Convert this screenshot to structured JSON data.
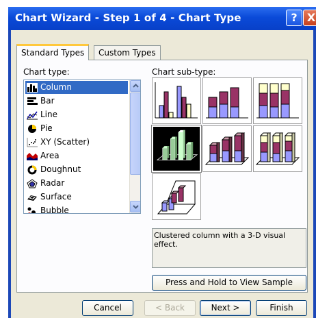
{
  "window": {
    "title": "Chart Wizard - Step 1 of 4 - Chart Type",
    "help_glyph": "?",
    "close_glyph": "X"
  },
  "tabs": [
    {
      "label": "Standard Types",
      "active": true
    },
    {
      "label": "Custom Types",
      "active": false
    }
  ],
  "chart_type": {
    "label": "Chart type:",
    "selected": "Column",
    "items": [
      {
        "label": "Column",
        "icon": "column-chart-icon"
      },
      {
        "label": "Bar",
        "icon": "bar-chart-icon"
      },
      {
        "label": "Line",
        "icon": "line-chart-icon"
      },
      {
        "label": "Pie",
        "icon": "pie-chart-icon"
      },
      {
        "label": "XY (Scatter)",
        "icon": "scatter-chart-icon"
      },
      {
        "label": "Area",
        "icon": "area-chart-icon"
      },
      {
        "label": "Doughnut",
        "icon": "doughnut-chart-icon"
      },
      {
        "label": "Radar",
        "icon": "radar-chart-icon"
      },
      {
        "label": "Surface",
        "icon": "surface-chart-icon"
      },
      {
        "label": "Bubble",
        "icon": "bubble-chart-icon"
      }
    ]
  },
  "chart_subtype": {
    "label": "Chart sub-type:",
    "selected_index": 3,
    "description": "Clustered column with a 3-D visual effect."
  },
  "sample_button": {
    "label": "Press and Hold to View Sample"
  },
  "footer": {
    "cancel": "Cancel",
    "back": "< Back",
    "next": "Next >",
    "finish": "Finish"
  },
  "colors": {
    "title_bar": "#0a4ad8",
    "selection": "#316ac5",
    "series_purple": "#9999ff",
    "series_maroon": "#993366",
    "series_cream": "#ffffcc",
    "series_green": "#99cc99",
    "series_lime": "#ccffcc"
  }
}
